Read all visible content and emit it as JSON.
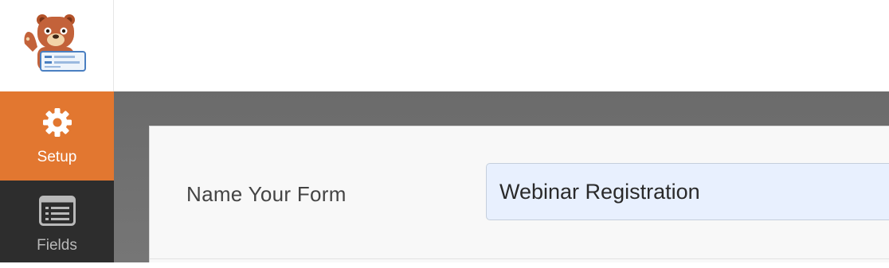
{
  "app": {
    "logo_icon": "bear-mascot-icon"
  },
  "sidebar": {
    "items": [
      {
        "label": "Setup",
        "icon": "gear-icon",
        "active": true
      },
      {
        "label": "Fields",
        "icon": "fields-list-icon",
        "active": false
      }
    ]
  },
  "setup": {
    "name_label": "Name Your Form",
    "name_value": "Webinar Registration"
  },
  "colors": {
    "accent": "#e27730",
    "sidebar_bg": "#2d2d2d",
    "input_bg": "#e8f0fe"
  }
}
